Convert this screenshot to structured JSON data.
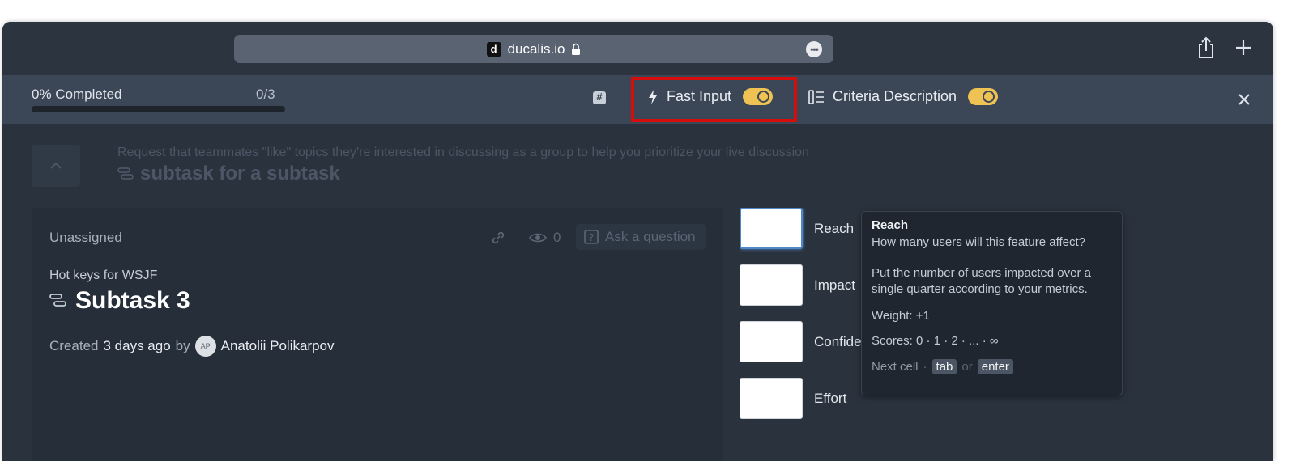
{
  "browser": {
    "favicon_letter": "d",
    "url": "ducalis.io",
    "more_glyph": "•••"
  },
  "toolbar": {
    "progress_label": "0% Completed",
    "progress_count": "0/3",
    "progress_fraction": 0,
    "fast_input_label": "Fast Input",
    "fast_input_on": true,
    "criteria_label": "Criteria Description",
    "criteria_on": true
  },
  "header": {
    "description": "Request that teammates \"like\" topics they're interested in discussing as a group to help you prioritize your live discussion",
    "parent_title": "subtask for a subtask"
  },
  "card": {
    "assignee": "Unassigned",
    "views_count": "0",
    "ask_label": "Ask a question",
    "project": "Hot keys for WSJF",
    "title": "Subtask 3",
    "created_prefix": "Created",
    "created_when": "3 days ago",
    "created_by": "by",
    "avatar_initials": "AP",
    "author": "Anatolii Polikarpov"
  },
  "criteria": [
    {
      "label": "Reach"
    },
    {
      "label": "Impact"
    },
    {
      "label": "Confidence"
    },
    {
      "label": "Effort"
    }
  ],
  "tooltip": {
    "title": "Reach",
    "question": "How many users will this feature affect?",
    "description": "Put the number of users impacted over a single quarter according to your metrics.",
    "weight": "Weight: +1",
    "scores": "Scores: 0 · 1 · 2 · ... · ∞",
    "next_label": "Next cell",
    "key_tab": "tab",
    "key_or": "or",
    "key_enter": "enter"
  },
  "colors": {
    "accent": "#eec253",
    "highlight": "#d60d0d",
    "background": "#2a323d"
  }
}
